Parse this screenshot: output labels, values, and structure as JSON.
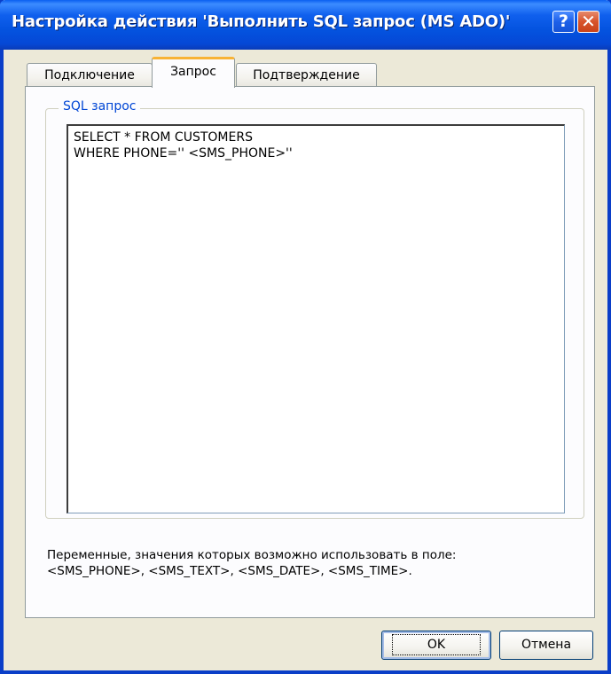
{
  "window": {
    "title": "Настройка действия 'Выполнить SQL запрос (MS ADO)'",
    "help_label": "?",
    "close_label": "✕"
  },
  "tabs": [
    {
      "label": "Подключение",
      "active": false
    },
    {
      "label": "Запрос",
      "active": true
    },
    {
      "label": "Подтверждение",
      "active": false
    }
  ],
  "group": {
    "title": "SQL запрос"
  },
  "sql": {
    "value": "SELECT * FROM CUSTOMERS\nWHERE PHONE='' <SMS_PHONE>''"
  },
  "hint": {
    "line1": "Переменные, значения которых возможно использовать в поле:",
    "line2": "<SMS_PHONE>, <SMS_TEXT>, <SMS_DATE>, <SMS_TIME>."
  },
  "buttons": {
    "ok_label": "OK",
    "cancel_label": "Отмена"
  },
  "colors": {
    "titlebar": "#0453df",
    "dialog_bg": "#ece9d8",
    "group_title": "#0046d5",
    "active_tab_accent": "#f8b335"
  }
}
